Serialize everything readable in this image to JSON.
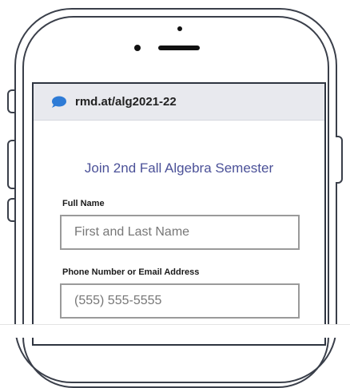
{
  "browser": {
    "url": "rmd.at/alg2021-22",
    "icon": "speech-bubble-icon"
  },
  "form": {
    "title": "Join 2nd Fall Algebra Semester",
    "full_name_label": "Full Name",
    "full_name_placeholder": "First and Last Name",
    "contact_label": "Phone Number or Email Address",
    "contact_placeholder": "(555) 555-5555"
  },
  "colors": {
    "title": "#4b5198",
    "url_icon": "#2e7bd6",
    "phone_outline": "#3a3f4a"
  }
}
